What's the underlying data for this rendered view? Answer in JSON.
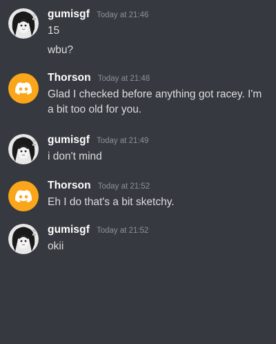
{
  "colors": {
    "background": "#36393f",
    "username": "#ffffff",
    "timestamp": "#8e9297",
    "text": "#dcddde",
    "discord_avatar_bg": "#faa61a"
  },
  "messages": [
    {
      "username": "gumisgf",
      "timestamp": "Today at 21:46",
      "avatar": "anime-avatar-icon",
      "lines": [
        "15",
        "wbu?"
      ]
    },
    {
      "username": "Thorson",
      "timestamp": "Today at 21:48",
      "avatar": "discord-logo-icon",
      "lines": [
        "Glad I checked before anything got racey. I'm",
        "a bit too old for you."
      ]
    },
    {
      "username": "gumisgf",
      "timestamp": "Today at 21:49",
      "avatar": "anime-avatar-icon",
      "lines": [
        "i don't mind"
      ]
    },
    {
      "username": "Thorson",
      "timestamp": "Today at 21:52",
      "avatar": "discord-logo-icon",
      "lines": [
        "Eh I do that's a bit sketchy."
      ]
    },
    {
      "username": "gumisgf",
      "timestamp": "Today at 21:52",
      "avatar": "anime-avatar-icon",
      "lines": [
        "okii"
      ]
    }
  ]
}
